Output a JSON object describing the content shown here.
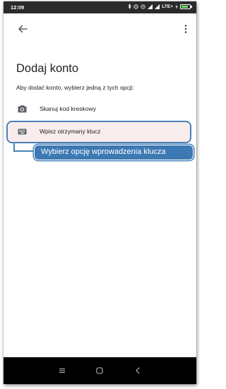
{
  "status_bar": {
    "time": "12:09",
    "network": "LTE+",
    "icons": [
      "bluetooth-icon",
      "vibrate-icon",
      "alarm-icon",
      "signal-icon",
      "signal-icon",
      "battery-icon"
    ]
  },
  "app_bar": {
    "back_icon": "arrow-left-icon",
    "more_icon": "more-vertical-icon"
  },
  "page": {
    "title": "Dodaj konto",
    "subtitle": "Aby dodać konto, wybierz jedną z tych opcji:"
  },
  "options": [
    {
      "label": "Skanuj kod kreskowy",
      "icon": "camera-icon"
    },
    {
      "label": "Wpisz otrzymany klucz",
      "icon": "keyboard-icon"
    }
  ],
  "callout": {
    "text": "Wybierz opcję wprowadzenia klucza"
  },
  "nav_bar": {
    "icons": [
      "menu-icon",
      "home-icon",
      "back-icon"
    ]
  },
  "colors": {
    "accent": "#4a80b8",
    "callout_bg": "#3d79b3",
    "highlight_bg": "#f8ecec",
    "status_bar": "#2b2b2b",
    "nav_bar": "#000000"
  }
}
